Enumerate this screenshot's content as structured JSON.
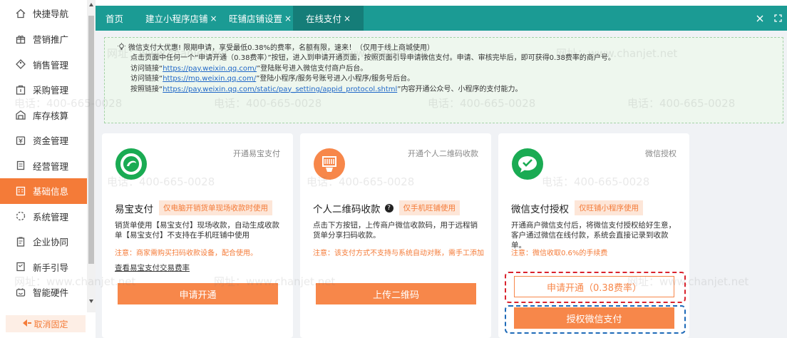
{
  "sidebar": {
    "items": [
      {
        "label": "快捷导航",
        "icon": "home-icon"
      },
      {
        "label": "营销推广",
        "icon": "gift-icon"
      },
      {
        "label": "销售管理",
        "icon": "tag-icon"
      },
      {
        "label": "采购管理",
        "icon": "cart-icon"
      },
      {
        "label": "库存核算",
        "icon": "warehouse-icon"
      },
      {
        "label": "资金管理",
        "icon": "coin-icon"
      },
      {
        "label": "经营管理",
        "icon": "document-icon"
      },
      {
        "label": "基础信息",
        "icon": "grid-icon",
        "active": true
      },
      {
        "label": "系统管理",
        "icon": "loading-icon"
      },
      {
        "label": "企业协同",
        "icon": "clipboard-icon"
      },
      {
        "label": "新手引导",
        "icon": "book-icon"
      },
      {
        "label": "智能硬件",
        "icon": "device-icon"
      }
    ],
    "unpin_label": "取消固定"
  },
  "tabs": [
    {
      "label": "首页",
      "closable": false
    },
    {
      "label": "建立小程序店铺",
      "closable": true
    },
    {
      "label": "旺铺店铺设置",
      "closable": true
    },
    {
      "label": "在线支付",
      "closable": true,
      "active": true
    }
  ],
  "tab_close_glyph": "×",
  "notice": {
    "line1": "微信支付大优惠! 限期申请，享受最低0.38%的费率，名额有限，速来！（仅用于线上商城使用）",
    "line2": "点击页面中任何一个“申请开通（0.38费率）”按钮，进入到申请开通页面，按照页面引导申请微信支付。申请、审核完毕后，即可获得0.38费率的商户号。",
    "line3_prefix": "访问链接“",
    "line3_link": "https://pay.weixin.qq.com/",
    "line3_suffix": "”登陆账号进入微信支付商户后台。",
    "line4_prefix": "访问链接“",
    "line4_link": "https://mp.weixin.qq.com/",
    "line4_suffix": "”登陆小程序/服务号账号进入小程序/服务号后台。",
    "line5_prefix": "按照链接“",
    "line5_link": "https://pay.weixin.qq.com/static/pay_setting/appid_protocol.shtml",
    "line5_suffix": "”内容开通公众号、小程序的支付能力。"
  },
  "cards": [
    {
      "corner": "开通易宝支付",
      "title": "易宝支付",
      "tag": "仅电脑开销货单现场收款时使用",
      "desc": "销货单使用【易宝支付】现场收款，自动生成收款单【易宝支付】不支持在手机旺铺中使用",
      "note": "注意：商家需购买扫码收款设备，配合使用。",
      "link": "查看易宝支付交易费率",
      "button": "申请开通"
    },
    {
      "corner": "开通个人二维码收款",
      "title": "个人二维码收款",
      "help": "?",
      "tag": "仅手机旺铺使用",
      "desc": "点击下方按钮，上传商户微信收款码，用于远程销货单分享扫码收款。",
      "note": "注意：该支付方式不支持与系统自动对账，需手工添加",
      "button": "上传二维码"
    },
    {
      "corner": "微信授权",
      "title": "微信支付授权",
      "tag": "仅旺铺小程序使用",
      "desc": "开通商户微信支付后，将微信支付授权给好生意，客户通过微信在线付款，系统会直接记录到收款单。",
      "note": "注意：微信收取0.6%的手续费",
      "button_apply": "申请开通（0.38费率）",
      "button_auth": "授权微信支付"
    }
  ],
  "watermarks": [
    "电话：400-665-0028",
    "网址：www.chanjet.net"
  ],
  "colors": {
    "accent": "#f47b38",
    "tabbar": "#1b9b94",
    "link": "#1f67c7"
  }
}
